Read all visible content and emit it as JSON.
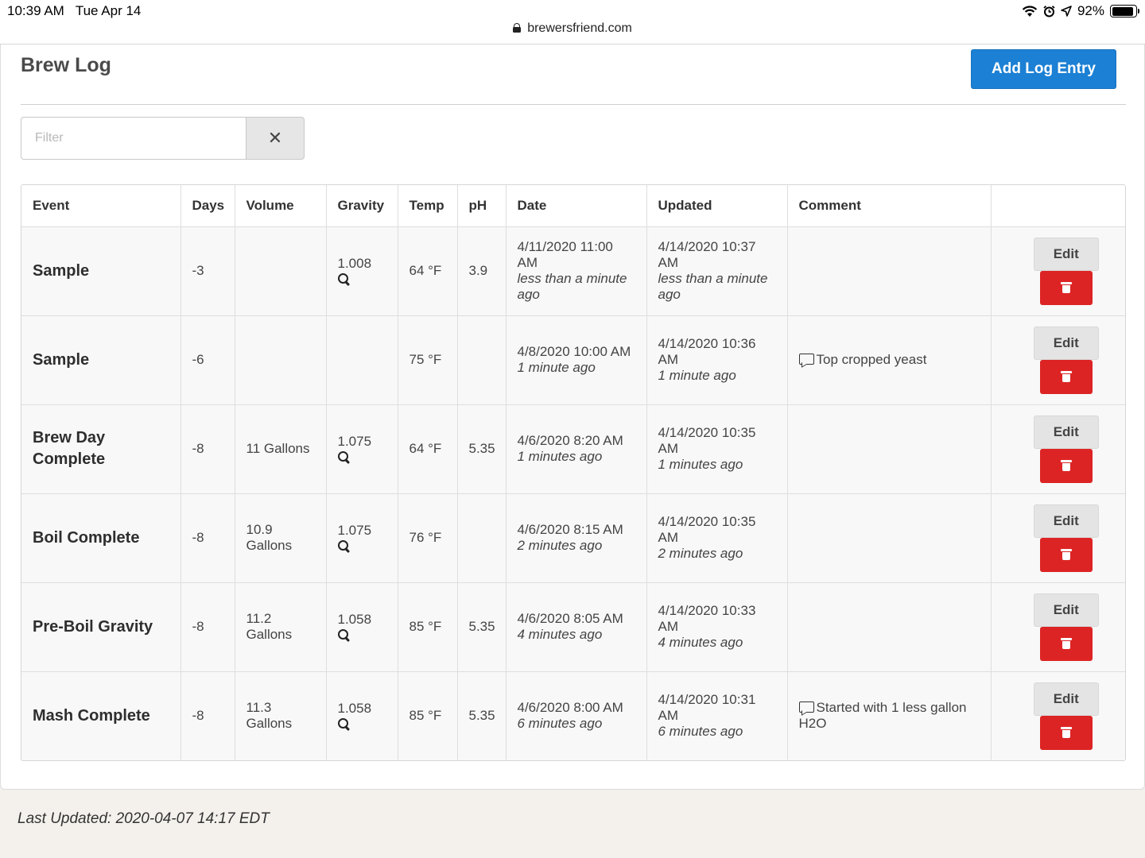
{
  "status_bar": {
    "time": "10:39 AM",
    "date": "Tue Apr 14",
    "battery": "92%",
    "battery_level": 0.92,
    "url": "brewersfriend.com",
    "icons": [
      "wifi-icon",
      "alarm-icon",
      "location-icon",
      "battery-icon"
    ]
  },
  "page": {
    "title": "Brew Log",
    "add_button": "Add Log Entry",
    "filter_placeholder": "Filter",
    "filter_clear": "✕"
  },
  "table": {
    "headers": {
      "event": "Event",
      "days": "Days",
      "volume": "Volume",
      "gravity": "Gravity",
      "temp": "Temp",
      "ph": "pH",
      "date": "Date",
      "updated": "Updated",
      "comment": "Comment"
    },
    "edit_label": "Edit",
    "rows": [
      {
        "event": "Sample",
        "days": "-3",
        "volume": "",
        "gravity": "1.008",
        "temp": "64 °F",
        "ph": "3.9",
        "date": "4/11/2020 11:00 AM",
        "date_rel": "less than a minute ago",
        "updated": "4/14/2020 10:37 AM",
        "updated_rel": "less than a minute ago",
        "comment": ""
      },
      {
        "event": "Sample",
        "days": "-6",
        "volume": "",
        "gravity": "",
        "temp": "75 °F",
        "ph": "",
        "date": "4/8/2020 10:00 AM",
        "date_rel": "1 minute ago",
        "updated": "4/14/2020 10:36 AM",
        "updated_rel": "1 minute ago",
        "comment": "Top cropped yeast"
      },
      {
        "event": "Brew Day Complete",
        "days": "-8",
        "volume": "11 Gallons",
        "gravity": "1.075",
        "temp": "64 °F",
        "ph": "5.35",
        "date": "4/6/2020 8:20 AM",
        "date_rel": "1 minutes ago",
        "updated": "4/14/2020 10:35 AM",
        "updated_rel": "1 minutes ago",
        "comment": ""
      },
      {
        "event": "Boil Complete",
        "days": "-8",
        "volume": "10.9 Gallons",
        "gravity": "1.075",
        "temp": "76 °F",
        "ph": "",
        "date": "4/6/2020 8:15 AM",
        "date_rel": "2 minutes ago",
        "updated": "4/14/2020 10:35 AM",
        "updated_rel": "2 minutes ago",
        "comment": ""
      },
      {
        "event": "Pre-Boil Gravity",
        "days": "-8",
        "volume": "11.2 Gallons",
        "gravity": "1.058",
        "temp": "85 °F",
        "ph": "5.35",
        "date": "4/6/2020 8:05 AM",
        "date_rel": "4 minutes ago",
        "updated": "4/14/2020 10:33 AM",
        "updated_rel": "4 minutes ago",
        "comment": ""
      },
      {
        "event": "Mash Complete",
        "days": "-8",
        "volume": "11.3 Gallons",
        "gravity": "1.058",
        "temp": "85 °F",
        "ph": "5.35",
        "date": "4/6/2020 8:00 AM",
        "date_rel": "6 minutes ago",
        "updated": "4/14/2020 10:31 AM",
        "updated_rel": "6 minutes ago",
        "comment": "Started with 1 less gallon H2O"
      }
    ]
  },
  "footer": {
    "last_updated": "Last Updated: 2020-04-07 14:17 EDT"
  }
}
